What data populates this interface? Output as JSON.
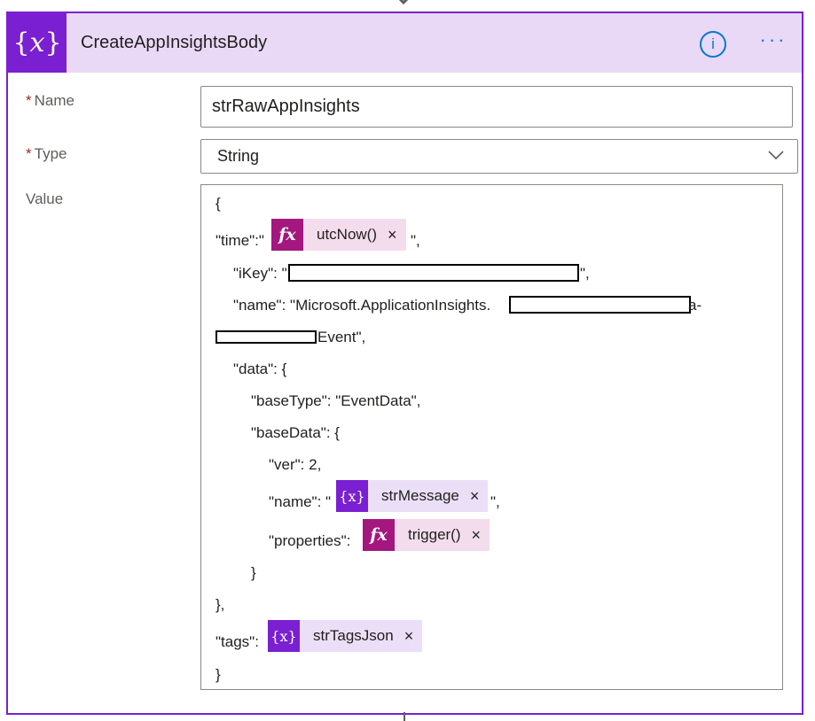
{
  "action": {
    "title": "CreateAppInsightsBody",
    "icon": "variable-icon",
    "accent_color": "#7a1fd1",
    "header_bg": "#ead9f6"
  },
  "fields": {
    "name_label": "Name",
    "name_value": "strRawAppInsights",
    "type_label": "Type",
    "type_value": "String",
    "value_label": "Value",
    "required_mark": "*"
  },
  "value_content": {
    "open_brace": "{",
    "time_prefix": "\"time\":\"",
    "time_token": "utcNow()",
    "time_suffix": "\",",
    "ikey_prefix": "\"iKey\": \"",
    "ikey_suffix": "\",",
    "name_prefix": "\"name\": \"Microsoft.ApplicationInsights.",
    "name_mid": "a-",
    "name_cont": "Event\",",
    "data_open": "\"data\": {",
    "base_type": "\"baseType\": \"EventData\",",
    "base_data_open": "\"baseData\": {",
    "ver": "\"ver\": 2,",
    "bd_name_prefix": "\"name\": \"",
    "bd_name_token": "strMessage",
    "bd_name_suffix": "\",",
    "properties_prefix": "\"properties\":",
    "properties_token": "trigger()",
    "inner_close": "}",
    "data_close": "},",
    "tags_prefix": "\"tags\":",
    "tags_token": "strTagsJson",
    "close_brace": "}"
  },
  "token_close": "×",
  "icons": {
    "info": "info-icon",
    "more": "more-options-icon",
    "chevron": "chevron-down-icon",
    "function": "function-icon",
    "variable": "variable-icon"
  },
  "glyphs": {
    "header_icon": "{𝑥}",
    "fx": "fx",
    "var": "{x}",
    "info": "i",
    "more": "···"
  }
}
